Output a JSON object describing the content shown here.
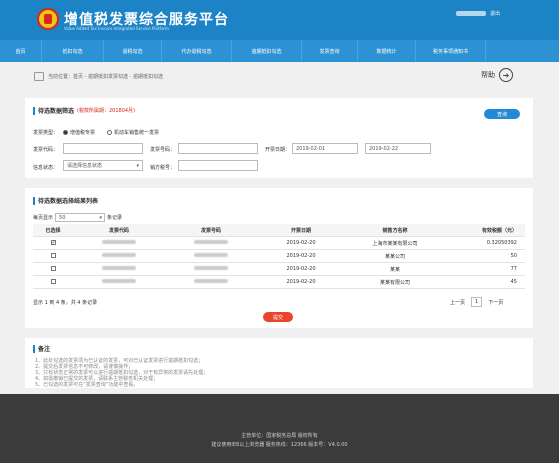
{
  "header": {
    "title": "增值税发票综合服务平台",
    "subtitle": "Value Added Tax Invoice Integrated Service Platform",
    "logout": "退出"
  },
  "nav": {
    "items": [
      "首页",
      "抵扣勾选",
      "退税勾选",
      "代办退税勾选",
      "逾期抵扣勾选",
      "发票查询",
      "数据统计",
      "税务事项通知书"
    ]
  },
  "breadcrumb": {
    "text": "当前位置：首页 - 逾期抵扣发票勾选 - 逾期抵扣勾选"
  },
  "help": {
    "label": "帮助",
    "icon": "arrow-right-icon"
  },
  "query": {
    "title": "待选数据筛选",
    "note": "(税款所属期：201804月)",
    "query_button": "查询",
    "type_label": "发票类型：",
    "type_options": [
      "增值税专票",
      "机动车销售统一发票"
    ],
    "code_label": "发票代码：",
    "number_label": "发票号码：",
    "date_label": "开票日期：",
    "date_from": "2019-02-01",
    "date_to": "2019-02-22",
    "status_label": "信息状态：",
    "status_value": "请选择信息状态",
    "seller_label": "销方税号："
  },
  "results": {
    "title": "待选数据选择结果列表",
    "page_size_prefix": "每页显示",
    "page_size": "50",
    "page_size_suffix": "条记录",
    "columns": [
      "已选择",
      "发票代码",
      "发票号码",
      "开票日期",
      "销售方名称",
      "有效税额（元）"
    ],
    "rows": [
      {
        "checked": "✓",
        "date": "2019-02-20",
        "seller": "上海市某某有限公司",
        "amount": "0.32050392"
      },
      {
        "checked": "",
        "date": "2019-02-20",
        "seller": "某某公司",
        "amount": "50"
      },
      {
        "checked": "",
        "date": "2019-02-20",
        "seller": "某某",
        "amount": "77"
      },
      {
        "checked": "",
        "date": "2019-02-20",
        "seller": "某某有限公司",
        "amount": "45"
      }
    ],
    "summary": "显示 1 到 4 条，共 4 条记录",
    "pager_prev": "上一页",
    "pager_current": "1",
    "pager_next": "下一页",
    "submit_button": "提交"
  },
  "notes": {
    "title": "备注",
    "lines": [
      "1、此处勾选的发票须为已认证的发票，可对已认证发票进行逾期抵扣勾选；",
      "2、提交后发票信息不可修改，请谨慎操作；",
      "3、只有状态正常的发票可以进行逾期抵扣勾选，对于有异常的发票请先处理；",
      "4、如需撤销已提交的发票，请联系主管税务机关处理；",
      "5、已勾选的发票可在“发票查询”功能中查看。"
    ]
  },
  "footer": {
    "line1": "主管单位：国家税务总局 版权所有",
    "line2": "建议使用IE8以上浏览器  服务热线：12366  版本号：V4.0.00"
  }
}
